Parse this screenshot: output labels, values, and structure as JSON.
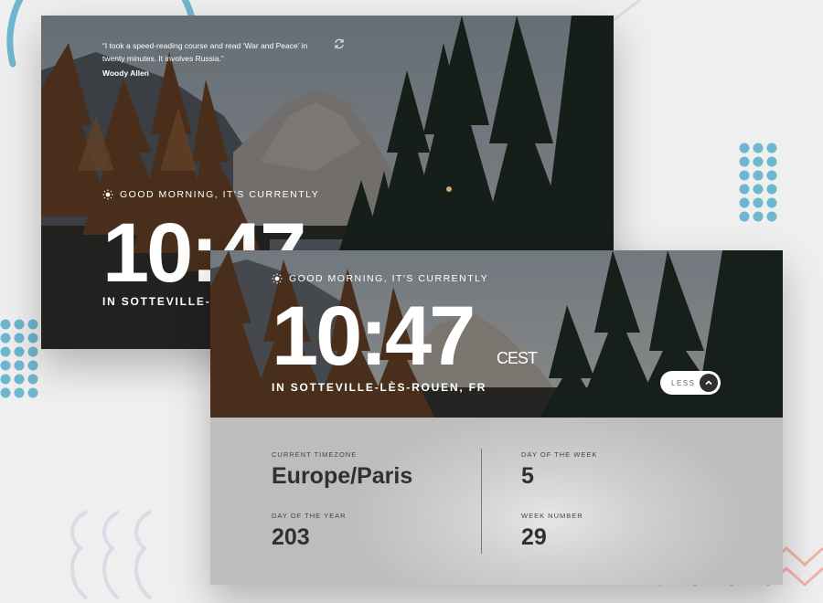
{
  "colors": {
    "accent_blue": "#6db7cf",
    "accent_pink": "#f2b3a8",
    "panel_text": "#303030"
  },
  "back_card": {
    "quote": "“I took a speed-reading course and read ‘War and Peace’ in twenty minutes. It involves Russia.”",
    "author": "Woody Allen",
    "refresh_icon": "refresh-icon",
    "greeting": "GOOD MORNING, IT'S CURRENTLY",
    "time": "10:47",
    "location": "IN SOTTEVILLE-LÈS-ROUEN, FR"
  },
  "front_card": {
    "greeting": "GOOD MORNING, IT'S CURRENTLY",
    "time": "10:47",
    "abbreviation": "CEST",
    "location": "IN SOTTEVILLE-LÈS-ROUEN, FR",
    "toggle_label": "LESS",
    "toggle_icon": "chevron-up-icon",
    "info": {
      "timezone_label": "CURRENT TIMEZONE",
      "timezone_value": "Europe/Paris",
      "day_of_year_label": "DAY OF THE YEAR",
      "day_of_year_value": "203",
      "day_of_week_label": "DAY OF THE WEEK",
      "day_of_week_value": "5",
      "week_number_label": "WEEK NUMBER",
      "week_number_value": "29"
    }
  }
}
